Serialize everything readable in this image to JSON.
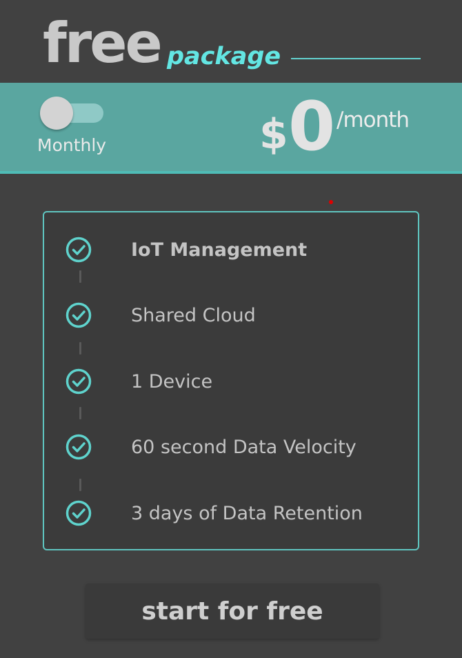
{
  "header": {
    "title": "free",
    "subtitle": "package"
  },
  "pricing": {
    "toggle_label": "Monthly",
    "toggle_on": false,
    "currency": "$",
    "amount": "0",
    "period": "/month"
  },
  "features": [
    {
      "label": "IoT Management",
      "icon": "check-circle-icon"
    },
    {
      "label": "Shared Cloud",
      "icon": "check-circle-icon"
    },
    {
      "label": "1 Device",
      "icon": "check-circle-icon"
    },
    {
      "label": "60 second Data Velocity",
      "icon": "check-circle-icon"
    },
    {
      "label": "3 days of Data Retention",
      "icon": "check-circle-icon"
    }
  ],
  "cta": {
    "label": "start for free"
  },
  "colors": {
    "background": "#414141",
    "accent": "#5fc5c0",
    "band": "#5aa6a0",
    "title": "#c9c9c9",
    "subtitle": "#63e6e3"
  }
}
